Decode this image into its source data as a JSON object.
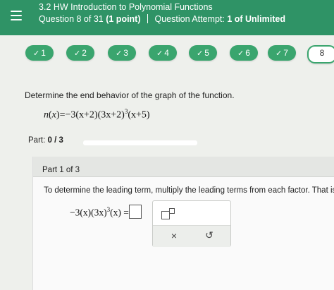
{
  "header": {
    "title": "3.2 HW Introduction to Polynomial Functions",
    "question_label": "Question 8 of 31",
    "points": "(1 point)",
    "attempt_label": "Question Attempt:",
    "attempt_value": "1 of Unlimited"
  },
  "question_nav": {
    "items": [
      {
        "label": "1",
        "done": true
      },
      {
        "label": "2",
        "done": true
      },
      {
        "label": "3",
        "done": true
      },
      {
        "label": "4",
        "done": true
      },
      {
        "label": "5",
        "done": true
      },
      {
        "label": "6",
        "done": true
      },
      {
        "label": "7",
        "done": true
      },
      {
        "label": "8",
        "done": false
      }
    ],
    "check_glyph": "✓"
  },
  "question": {
    "prompt": "Determine the end behavior of the graph of the function.",
    "fn_lhs": "n",
    "fn_var": "x",
    "fn_body_1": "=−3",
    "fn_body_2": "(x+2)(3x+2)",
    "fn_exp": "3",
    "fn_body_3": "(x+5)"
  },
  "part": {
    "label": "Part:",
    "progress": "0 / 3",
    "progress_fraction": 0,
    "title": "Part 1 of 3",
    "instruction": "To determine the leading term, multiply the leading terms from each factor. That is,",
    "expr_1": "−3(x)(3x)",
    "expr_exp": "3",
    "expr_2": "(x) ="
  },
  "palette": {
    "clear_glyph": "×",
    "undo_glyph": "↺"
  },
  "colors": {
    "header": "#2f9366",
    "pill": "#3aa56e"
  }
}
